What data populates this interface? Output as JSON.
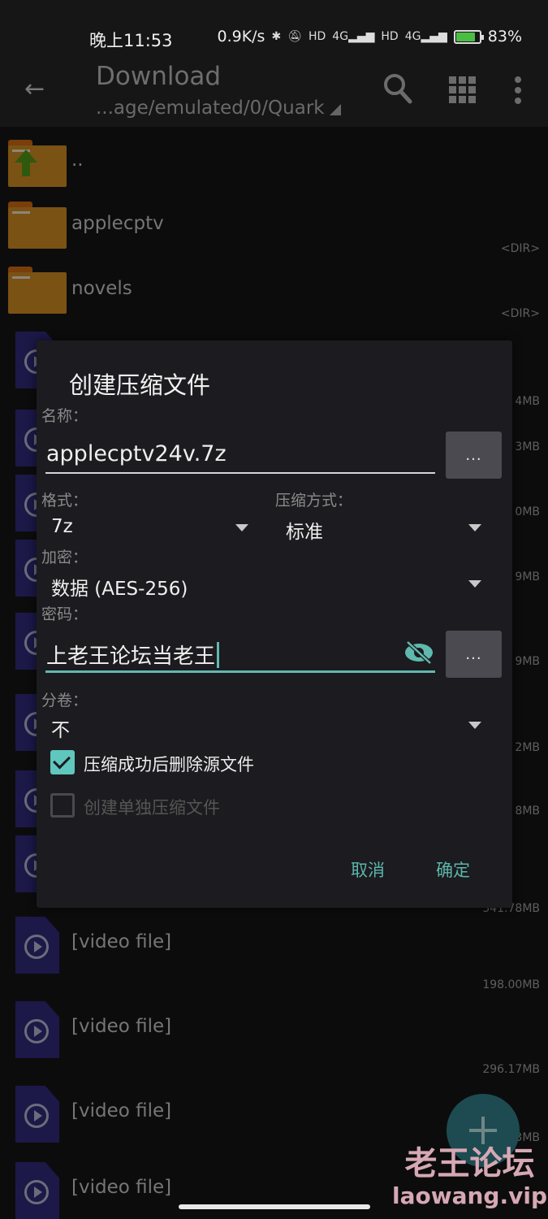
{
  "status_bar": {
    "time": "晚上11:53",
    "net_speed": "0.9K/s",
    "icons": [
      "bluetooth-icon",
      "mute-icon",
      "hd-icon",
      "signal-4g-icon",
      "hd-icon",
      "signal-4g-icon",
      "battery-charging-icon"
    ],
    "sim_label": "4G",
    "hd_label": "HD",
    "battery_percent": "83%",
    "battery_level": 0.83
  },
  "app_bar": {
    "title": "Download",
    "path": "...age/emulated/0/Quark",
    "back_icon": "arrow-left-icon",
    "search_icon": "search-icon",
    "view_icon": "grid-view-icon",
    "more_icon": "more-vert-icon"
  },
  "file_list": {
    "parent": {
      "name": ".."
    },
    "folders": [
      {
        "name": "applecptv",
        "size": "<DIR>"
      },
      {
        "name": "novels",
        "size": "<DIR>"
      }
    ],
    "hidden_sizes": [
      "4MB",
      "3MB",
      "0MB",
      "9MB",
      "9MB",
      "2MB",
      "8MB"
    ],
    "videos": [
      {
        "name": "[video file]",
        "size": "341.78MB"
      },
      {
        "name": "[video file]",
        "size": "198.00MB"
      },
      {
        "name": "[video file]",
        "size": "296.17MB"
      },
      {
        "name": "[video file]",
        "size": "3MB"
      },
      {
        "name": "[video file]",
        "size": ""
      }
    ]
  },
  "dialog": {
    "title": "创建压缩文件",
    "name_label": "名称：",
    "name_value": "applecptv24v.7z",
    "browse_label": "...",
    "format_label": "格式：",
    "format_value": "7z",
    "method_label": "压缩方式：",
    "method_value": "标准",
    "encrypt_label": "加密：",
    "encrypt_value": "数据 (AES-256)",
    "password_label": "密码：",
    "password_value": "上老王论坛当老王",
    "password_menu_label": "...",
    "split_label": "分卷：",
    "split_value": "不",
    "delete_after_label": "压缩成功后删除源文件",
    "delete_after_checked": true,
    "separate_archives_label": "创建单独压缩文件",
    "separate_archives_checked": false,
    "cancel_label": "取消",
    "ok_label": "确定",
    "accent_color": "#5fb9ae"
  },
  "fab": {
    "icon": "plus-icon"
  },
  "watermark": {
    "cn": "老王论坛",
    "url": "laowang.vip"
  }
}
